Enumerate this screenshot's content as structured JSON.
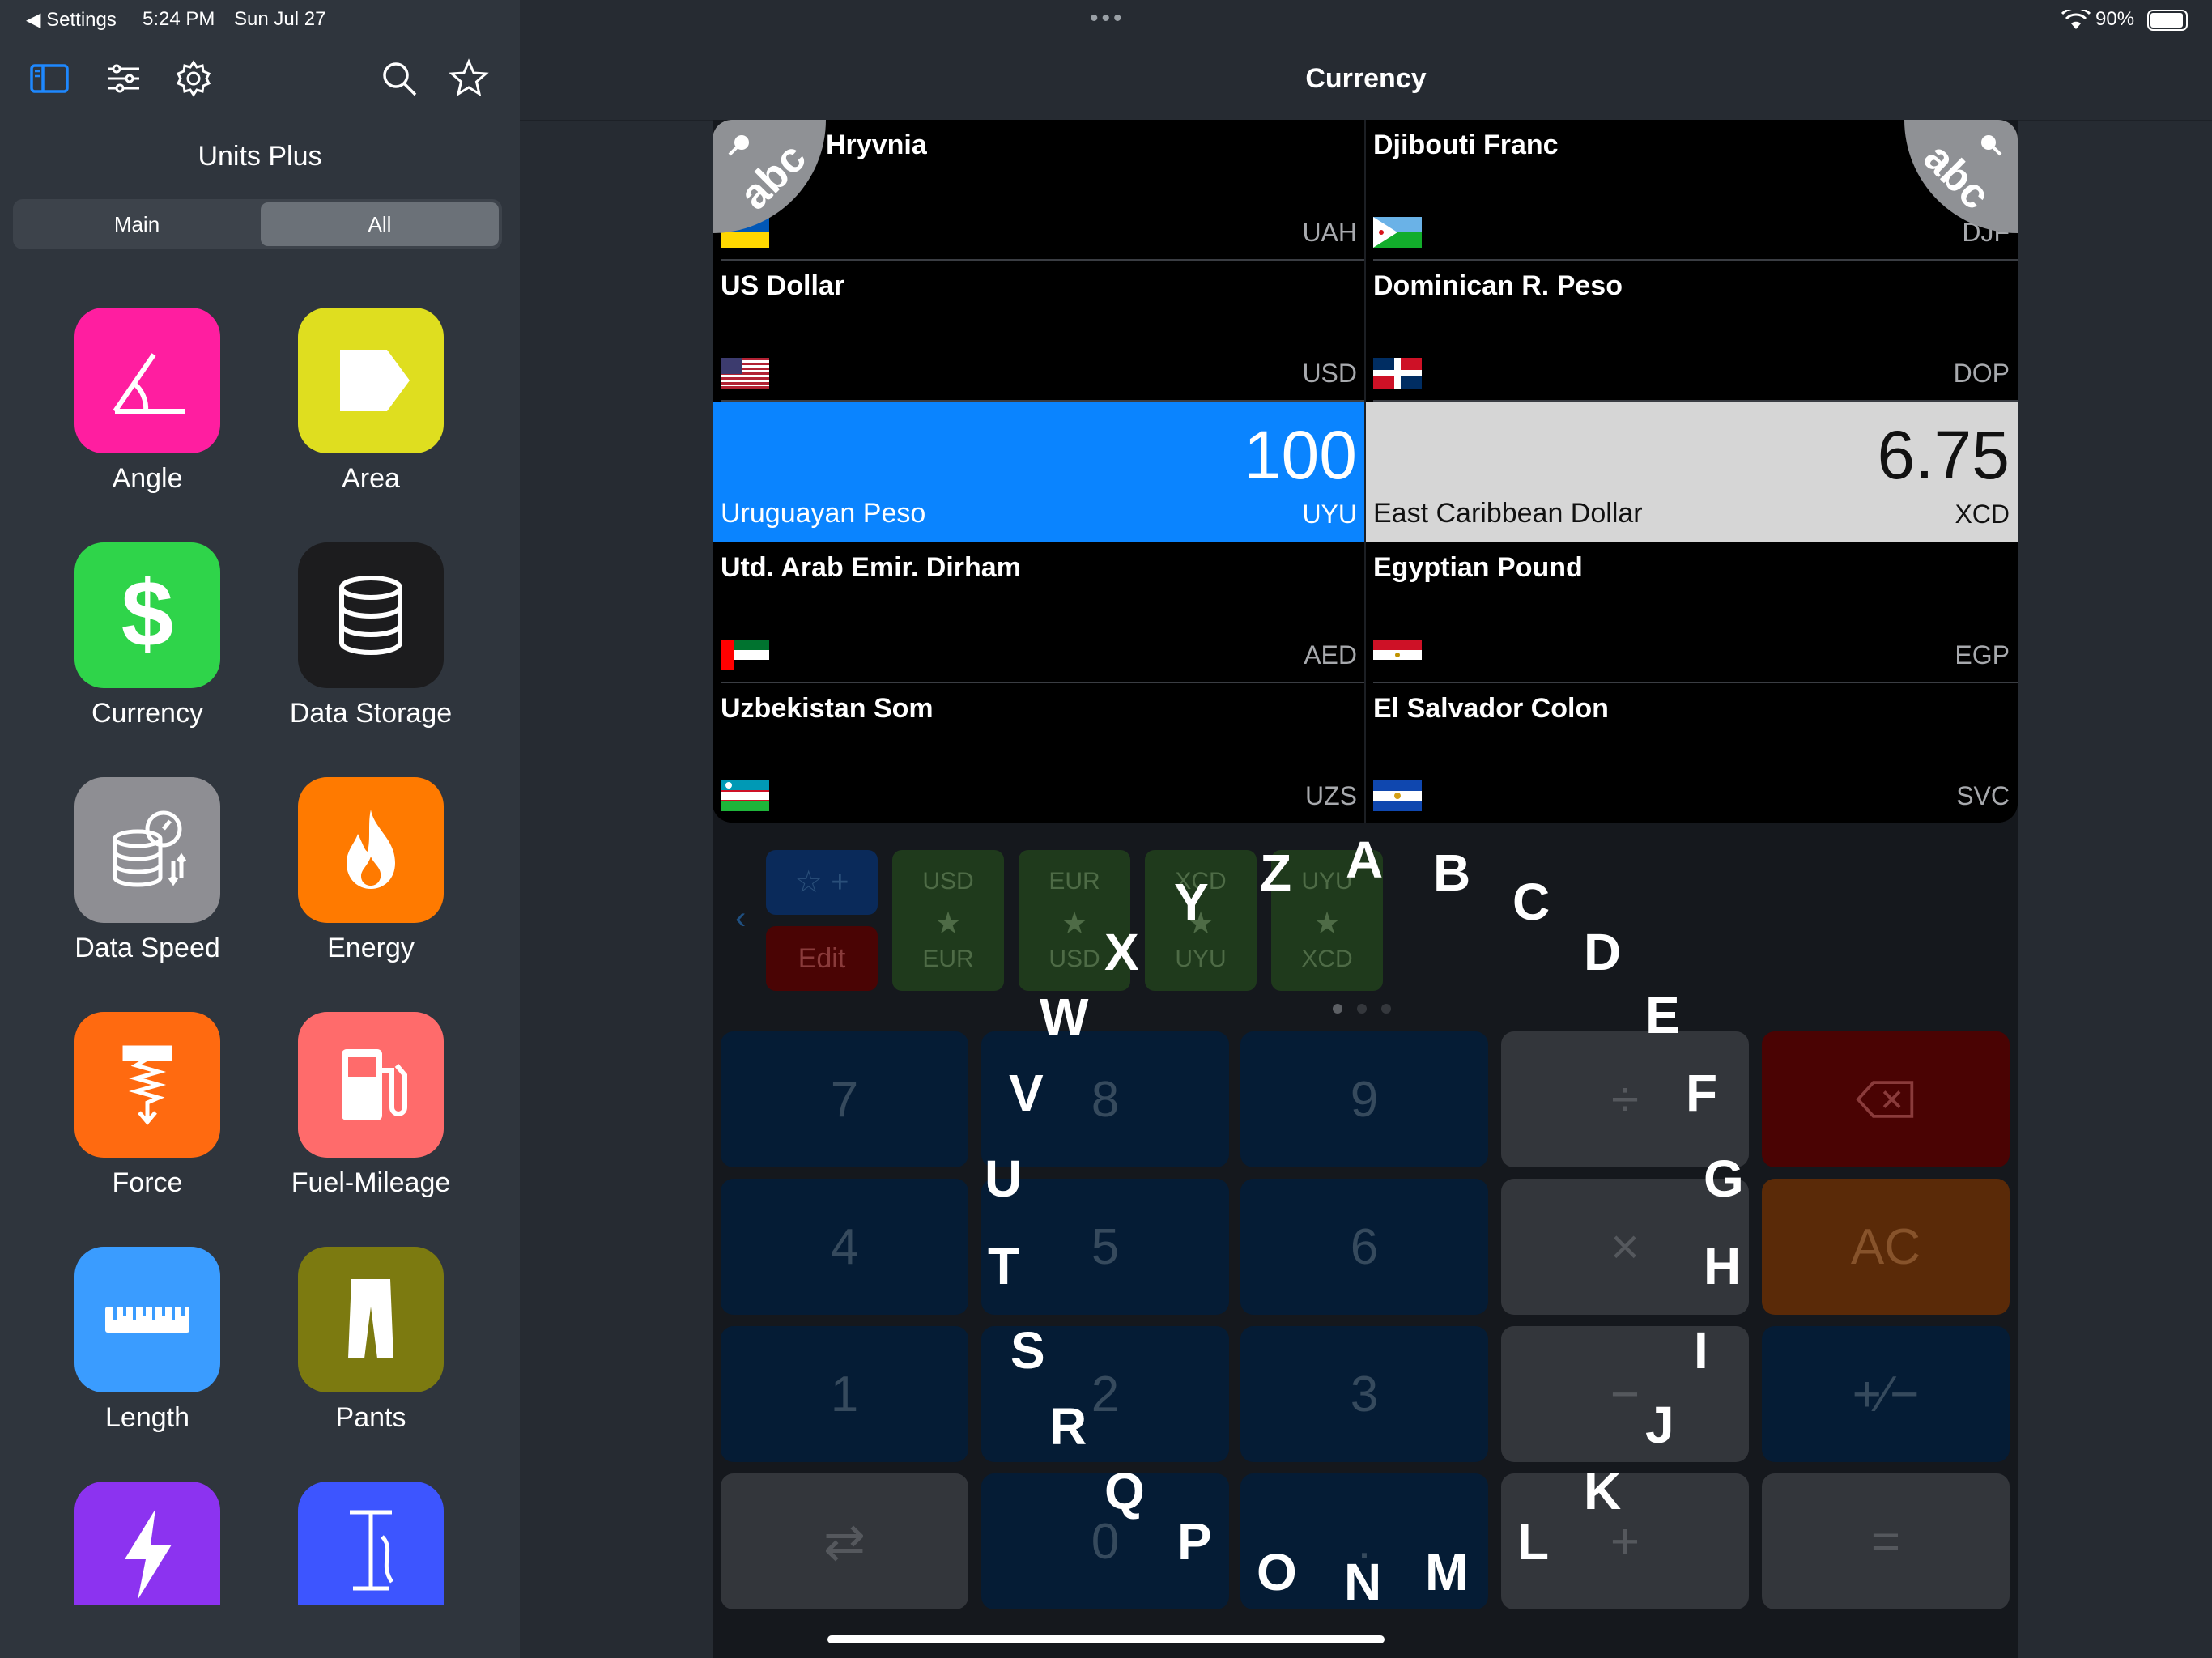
{
  "status_bar": {
    "back": "◀ Settings",
    "time": "5:24 PM",
    "date": "Sun Jul 27",
    "battery": "90%"
  },
  "sidebar": {
    "title": "Units Plus",
    "segments": [
      "Main",
      "All"
    ],
    "selected_segment": "All",
    "categories": [
      {
        "label": "Angle",
        "icon": "angle-icon",
        "color": "#ff1ea0"
      },
      {
        "label": "Area",
        "icon": "area-icon",
        "color": "#dfde1f"
      },
      {
        "label": "Currency",
        "icon": "dollar-icon",
        "color": "#2fd44a"
      },
      {
        "label": "Data Storage",
        "icon": "database-icon",
        "color": "#1c1c1e"
      },
      {
        "label": "Data Speed",
        "icon": "data-speed-icon",
        "color": "#8e8e93"
      },
      {
        "label": "Energy",
        "icon": "flame-icon",
        "color": "#ff7a00"
      },
      {
        "label": "Force",
        "icon": "spring-icon",
        "color": "#ff6a10"
      },
      {
        "label": "Fuel-Mileage",
        "icon": "fuel-pump-icon",
        "color": "#ff6b6b"
      },
      {
        "label": "Length",
        "icon": "ruler-icon",
        "color": "#3a9cff"
      },
      {
        "label": "Pants",
        "icon": "pants-icon",
        "color": "#7c7a10"
      },
      {
        "label": "",
        "icon": "lightning-icon",
        "color": "#8c33f0"
      },
      {
        "label": "",
        "icon": "pump-icon",
        "color": "#3d55ff"
      }
    ]
  },
  "main": {
    "title": "Currency",
    "currencies": [
      {
        "name": "Hryvnia",
        "code": "UAH",
        "flag": "ua"
      },
      {
        "name": "Djibouti Franc",
        "code": "DJF",
        "flag": "dj"
      },
      {
        "name": "US Dollar",
        "code": "USD",
        "flag": "us"
      },
      {
        "name": "Dominican R. Peso",
        "code": "DOP",
        "flag": "do"
      },
      {
        "name": "Uruguayan Peso",
        "code": "UYU",
        "value": "100",
        "selected": "input"
      },
      {
        "name": "East Caribbean Dollar",
        "code": "XCD",
        "value": "6.75",
        "selected": "output"
      },
      {
        "name": "Utd. Arab Emir. Dirham",
        "code": "AED",
        "flag": "ae"
      },
      {
        "name": "Egyptian Pound",
        "code": "EGP",
        "flag": "eg"
      },
      {
        "name": "Uzbekistan Som",
        "code": "UZS",
        "flag": "uz"
      },
      {
        "name": "El Salvador Colon",
        "code": "SVC",
        "flag": "sv"
      }
    ],
    "badge_text": "abc",
    "add_favorite": "☆ +",
    "edit_label": "Edit",
    "favorites": [
      {
        "top": "USD",
        "bottom": "EUR"
      },
      {
        "top": "EUR",
        "bottom": "USD"
      },
      {
        "top": "XCD",
        "bottom": "UYU"
      },
      {
        "top": "UYU",
        "bottom": "XCD"
      }
    ],
    "keypad": {
      "rows": [
        [
          "7",
          "8",
          "9",
          "÷",
          "⌫"
        ],
        [
          "4",
          "5",
          "6",
          "×",
          "AC"
        ],
        [
          "1",
          "2",
          "3",
          "−",
          "+⁄−"
        ],
        [
          "⇄",
          "0",
          ".",
          "+",
          "="
        ]
      ]
    }
  },
  "overlay_labels": [
    "A",
    "B",
    "C",
    "D",
    "E",
    "F",
    "G",
    "H",
    "I",
    "J",
    "K",
    "L",
    "M",
    "N",
    "O",
    "P",
    "Q",
    "R",
    "S",
    "T",
    "U",
    "V",
    "W",
    "X",
    "Y",
    "Z"
  ]
}
